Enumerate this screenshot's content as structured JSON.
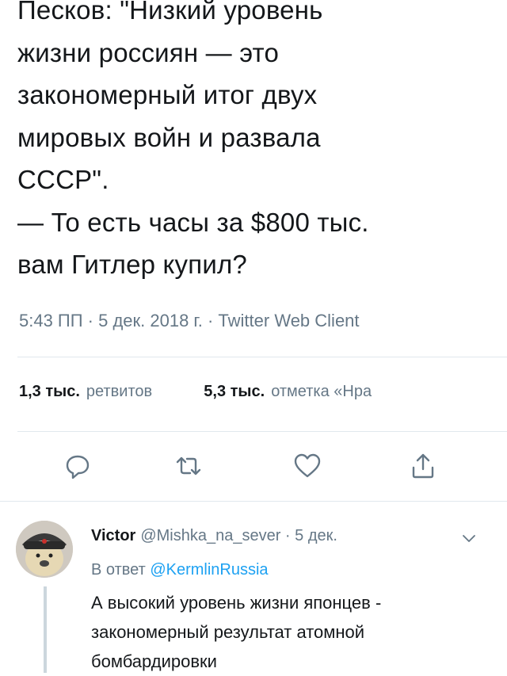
{
  "tweet": {
    "lines": [
      "Песков: \"Низкий уровень",
      "жизни россиян — это",
      "закономерный итог двух",
      "мировых войн и развала",
      "СССР\".",
      "— То есть часы за $800 тыс.",
      "вам Гитлер купил?"
    ],
    "meta": "5:43 ПП · 5 дек. 2018 г. · Twitter Web Client"
  },
  "stats": {
    "retweets_count": "1,3 тыс.",
    "retweets_label": "ретвитов",
    "likes_count": "5,3 тыс.",
    "likes_label": "отметка «Нра"
  },
  "actions": {
    "reply_icon": "reply-icon",
    "retweet_icon": "retweet-icon",
    "like_icon": "heart-icon",
    "share_icon": "share-icon",
    "color": "#657786"
  },
  "reply": {
    "name": "Victor",
    "handle": "@Mishka_na_sever · 5 дек.",
    "reply_to_prefix": "В ответ",
    "reply_to_mention": "@KermlinRussia",
    "lines": [
      "А высокий уровень жизни японцев -",
      "закономерный результат атомной",
      "бомбардировки"
    ],
    "link_color": "#1da1f2"
  }
}
